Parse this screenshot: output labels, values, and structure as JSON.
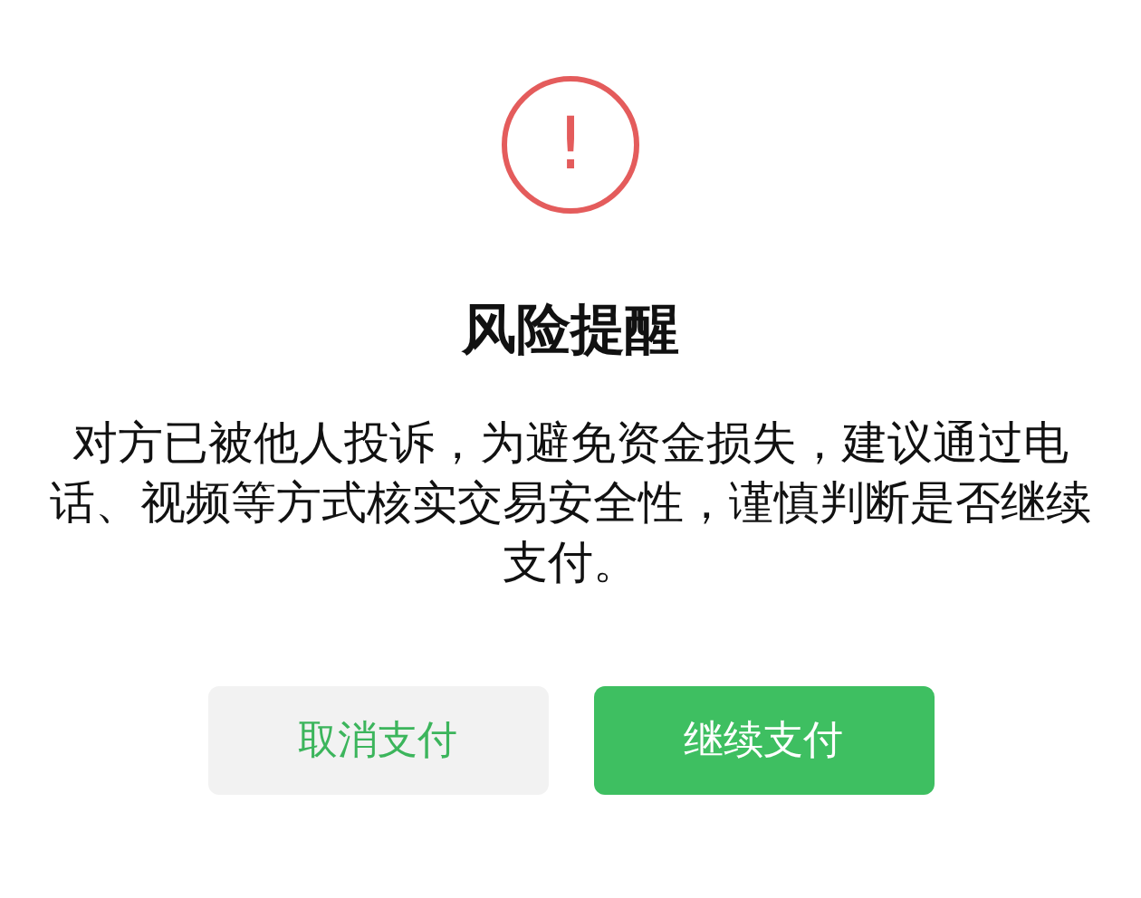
{
  "dialog": {
    "icon": "!",
    "title": "风险提醒",
    "message": "对方已被他人投诉，为避免资金损失，建议通过电话、视频等方式核实交易安全性，谨慎判断是否继续支付。",
    "buttons": [
      {
        "label": "取消支付",
        "kind": "secondary"
      },
      {
        "label": "继续支付",
        "kind": "primary"
      }
    ]
  }
}
